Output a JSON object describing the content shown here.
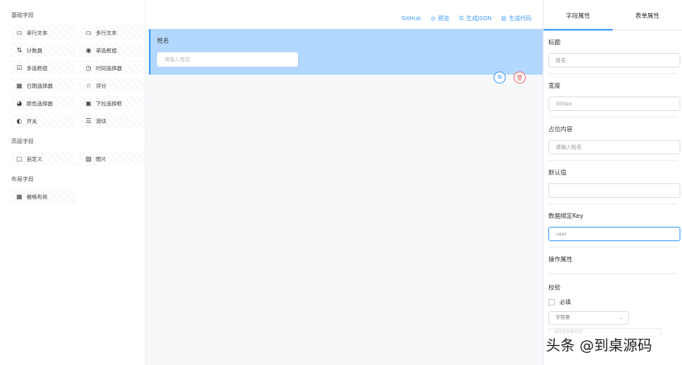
{
  "left": {
    "basic_title": "基础字段",
    "basic": [
      {
        "icon": "single-line-text-icon",
        "glyph": "▭",
        "label": "单行文本"
      },
      {
        "icon": "multi-line-text-icon",
        "glyph": "▭",
        "label": "多行文本"
      },
      {
        "icon": "counter-icon",
        "glyph": "⇅",
        "label": "计数器"
      },
      {
        "icon": "radio-icon",
        "glyph": "◉",
        "label": "单选框组"
      },
      {
        "icon": "checkbox-icon",
        "glyph": "☑",
        "label": "多选框组"
      },
      {
        "icon": "clock-icon",
        "glyph": "◷",
        "label": "时间选择器"
      },
      {
        "icon": "calendar-icon",
        "glyph": "▦",
        "label": "日期选择器"
      },
      {
        "icon": "star-icon",
        "glyph": "☆",
        "label": "评分"
      },
      {
        "icon": "palette-icon",
        "glyph": "◕",
        "label": "颜色选择器"
      },
      {
        "icon": "dropdown-icon",
        "glyph": "▣",
        "label": "下拉选择框"
      },
      {
        "icon": "switch-icon",
        "glyph": "◐",
        "label": "开关"
      },
      {
        "icon": "slider-icon",
        "glyph": "☰",
        "label": "滑块"
      }
    ],
    "advanced_title": "高级字段",
    "advanced": [
      {
        "icon": "custom-icon",
        "glyph": "▢",
        "label": "自定义"
      },
      {
        "icon": "image-icon",
        "glyph": "▨",
        "label": "图片"
      }
    ],
    "layout_title": "布局字段",
    "layout": [
      {
        "icon": "grid-icon",
        "glyph": "▦",
        "label": "栅格布局"
      }
    ]
  },
  "toolbar": {
    "github": "GitHub",
    "preview": "预览",
    "gen_json": "生成JSON",
    "gen_code": "生成代码"
  },
  "canvas": {
    "field_label": "姓名",
    "field_placeholder": "请输入姓名"
  },
  "right": {
    "tab_field": "字段属性",
    "tab_form": "表单属性",
    "title_label": "标题",
    "title_value": "姓名",
    "width_label": "宽度",
    "width_value": "300px",
    "placeholder_label": "占位内容",
    "placeholder_value": "请输入姓名",
    "default_label": "默认值",
    "default_value": "",
    "key_label": "数据绑定Key",
    "key_value": "user",
    "ops_label": "操作属性",
    "validate_label": "校验",
    "required_label": "必填",
    "type_value": "字符串",
    "pattern_placeholder": "填写正则表达式"
  },
  "watermark": "头条 @到桌源码"
}
